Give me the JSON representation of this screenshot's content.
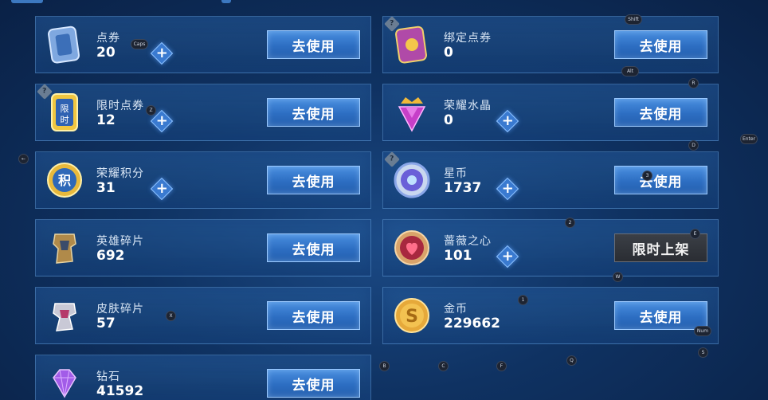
{
  "use_label": "去使用",
  "limited_label": "限时上架",
  "currencies": [
    {
      "name": "点券",
      "amount": "20",
      "plus": true,
      "help": false,
      "action": "use",
      "icon": "ticket-icon"
    },
    {
      "name": "绑定点券",
      "amount": "0",
      "plus": false,
      "help": true,
      "action": "use",
      "icon": "bound-ticket-icon"
    },
    {
      "name": "限时点券",
      "amount": "12",
      "plus": true,
      "help": true,
      "action": "use",
      "icon": "limited-ticket-icon"
    },
    {
      "name": "荣耀水晶",
      "amount": "0",
      "plus": true,
      "help": false,
      "action": "use",
      "icon": "glory-crystal-icon"
    },
    {
      "name": "荣耀积分",
      "amount": "31",
      "plus": true,
      "help": false,
      "action": "use",
      "icon": "glory-points-icon"
    },
    {
      "name": "星币",
      "amount": "1737",
      "plus": true,
      "help": true,
      "action": "use",
      "icon": "star-coin-icon"
    },
    {
      "name": "英雄碎片",
      "amount": "692",
      "plus": false,
      "help": false,
      "action": "use",
      "icon": "hero-fragment-icon"
    },
    {
      "name": "蔷薇之心",
      "amount": "101",
      "plus": true,
      "help": false,
      "action": "limited",
      "icon": "rose-heart-icon"
    },
    {
      "name": "皮肤碎片",
      "amount": "57",
      "plus": false,
      "help": false,
      "action": "use",
      "icon": "skin-fragment-icon"
    },
    {
      "name": "金币",
      "amount": "229662",
      "plus": false,
      "help": false,
      "action": "use",
      "icon": "gold-coin-icon"
    },
    {
      "name": "钻石",
      "amount": "41592",
      "plus": false,
      "help": false,
      "action": "use",
      "icon": "diamond-icon"
    }
  ],
  "key_hints": [
    "Shift",
    "Alt",
    "R",
    "Enter",
    "D",
    "Caps",
    "Z",
    "←",
    "3",
    "2",
    "E",
    "W",
    "1",
    "X",
    "Num",
    "S",
    "B",
    "C",
    "F",
    "Q"
  ],
  "colors": {
    "card_bg": "#1d4f8a",
    "button": "#2d6ec2",
    "limited_button": "#2a2d33"
  }
}
